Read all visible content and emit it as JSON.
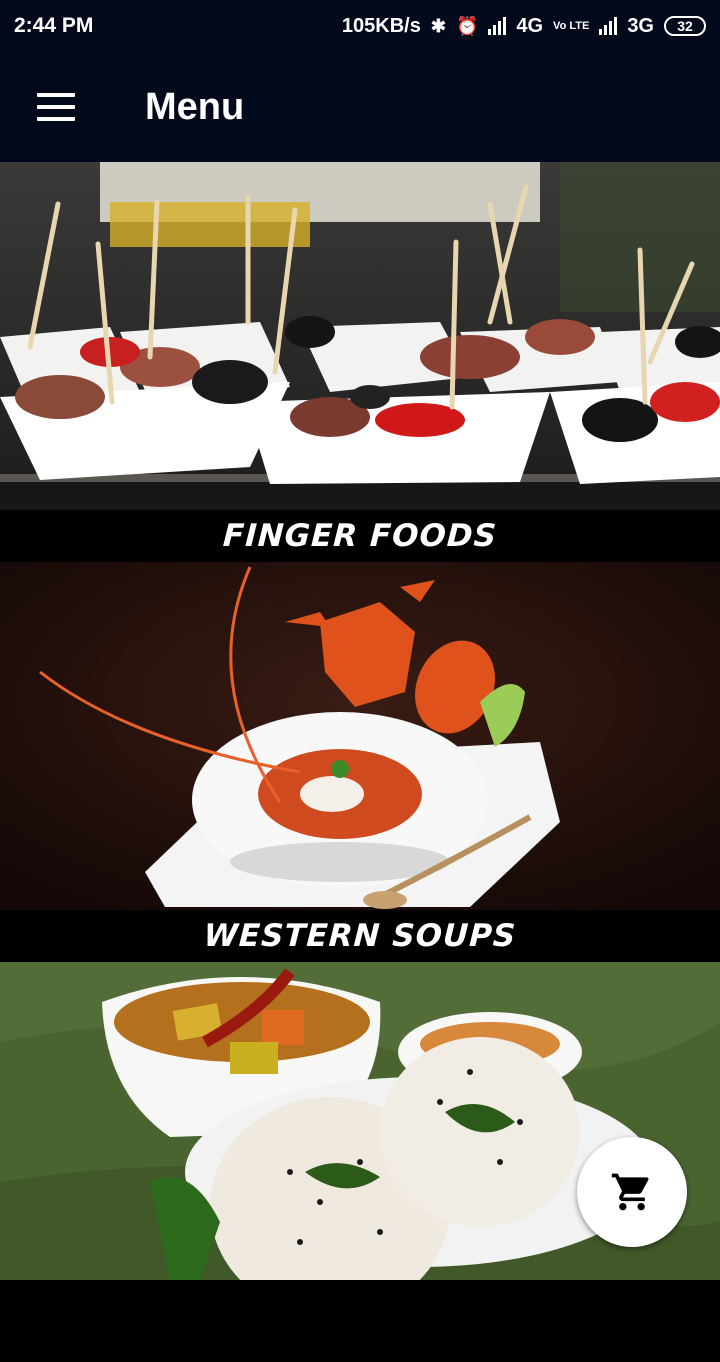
{
  "status_bar": {
    "time": "2:44 PM",
    "speed": "105KB/s",
    "net1": "4G",
    "volte": "Vo LTE",
    "net2": "3G",
    "battery": "32",
    "icons": [
      "bluetooth-icon",
      "alarm-icon",
      "signal-icon",
      "signal-icon"
    ]
  },
  "app_bar": {
    "title": "Menu",
    "menu_icon": "hamburger-icon"
  },
  "categories": [
    {
      "label": "FINGER FOODS",
      "image": "finger-foods-photo"
    },
    {
      "label": "WESTERN SOUPS",
      "image": "western-soups-photo"
    },
    {
      "label": "",
      "image": "south-indian-photo"
    }
  ],
  "fab": {
    "icon": "cart-icon"
  },
  "colors": {
    "app_bar": "#030a1c",
    "label_bar": "#000000",
    "fab": "#ffffff"
  }
}
